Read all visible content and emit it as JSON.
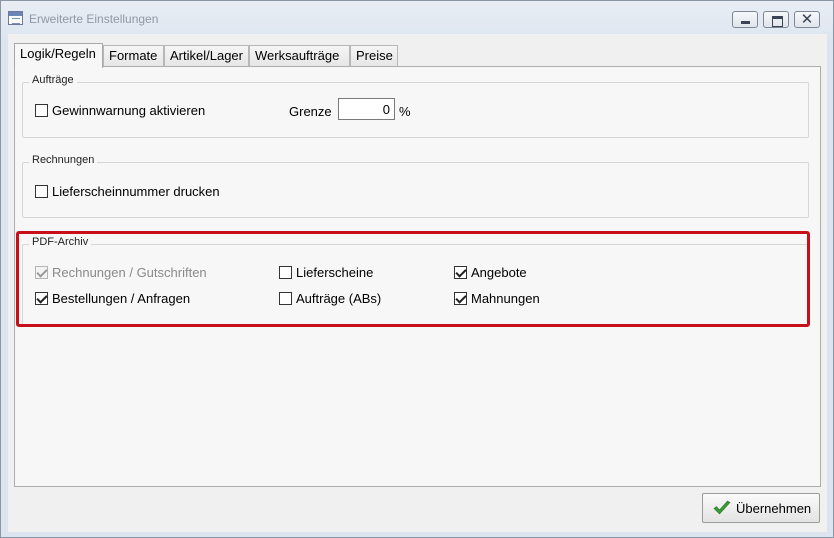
{
  "window": {
    "title": "Erweiterte Einstellungen",
    "close_glyph": "✕"
  },
  "tabs": [
    "Logik/Regeln",
    "Formate",
    "Artikel/Lager",
    "Werksaufträge",
    "Preise"
  ],
  "active_tab": "Logik/Regeln",
  "groups": {
    "auftraege": {
      "title": "Aufträge",
      "gewinnwarnung": {
        "label": "Gewinnwarnung aktivieren",
        "checked": false
      },
      "grenze": {
        "label": "Grenze",
        "value": "0",
        "unit": "%"
      }
    },
    "rechnungen": {
      "title": "Rechnungen",
      "lieferscheinnummer": {
        "label": "Lieferscheinnummer drucken",
        "checked": false
      }
    },
    "pdf_archiv": {
      "title": "PDF-Archiv",
      "items": [
        {
          "label": "Rechnungen / Gutschriften",
          "checked": true,
          "disabled": true
        },
        {
          "label": "Lieferscheine",
          "checked": false,
          "disabled": false
        },
        {
          "label": "Angebote",
          "checked": true,
          "disabled": false
        },
        {
          "label": "Bestellungen / Anfragen",
          "checked": true,
          "disabled": false
        },
        {
          "label": "Aufträge (ABs)",
          "checked": false,
          "disabled": false
        },
        {
          "label": "Mahnungen",
          "checked": true,
          "disabled": false
        }
      ]
    }
  },
  "footer": {
    "apply_label": "Übernehmen"
  },
  "colors": {
    "highlight": "#c8101a",
    "check_green": "#3a9a35"
  },
  "icons": {
    "apply": "check-icon",
    "window": "app-icon"
  }
}
